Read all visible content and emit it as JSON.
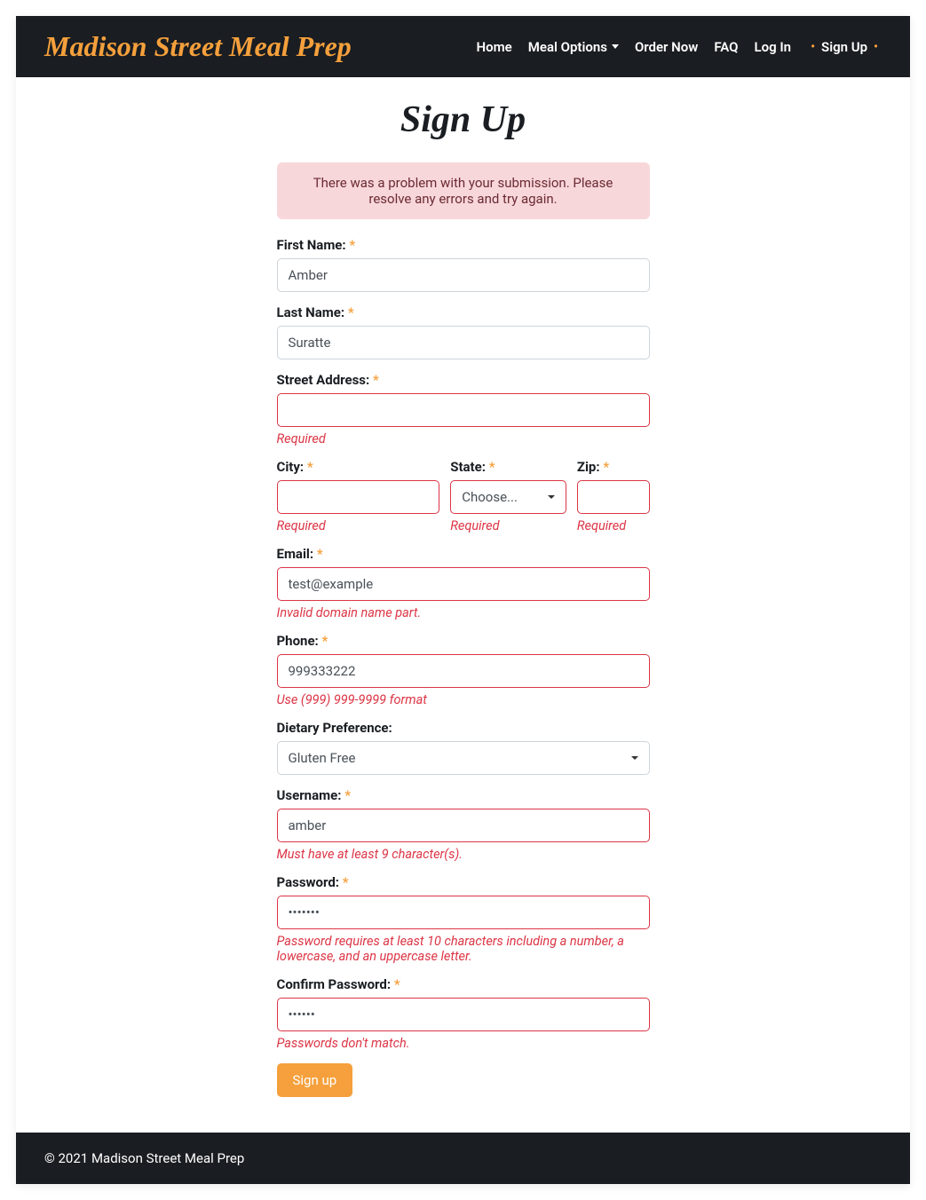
{
  "brand": "Madison Street Meal Prep",
  "nav": {
    "home": "Home",
    "meal_options": "Meal Options",
    "order_now": "Order Now",
    "faq": "FAQ",
    "log_in": "Log In",
    "sign_up": "Sign Up"
  },
  "page_title": "Sign Up",
  "alert": "There was a problem with your submission. Please resolve any errors and try again.",
  "form": {
    "first_name": {
      "label": "First Name:",
      "value": "Amber"
    },
    "last_name": {
      "label": "Last Name:",
      "value": "Suratte"
    },
    "street_address": {
      "label": "Street Address:",
      "value": "",
      "error": "Required"
    },
    "city": {
      "label": "City:",
      "value": "",
      "error": "Required"
    },
    "state": {
      "label": "State:",
      "selected": "Choose...",
      "error": "Required"
    },
    "zip": {
      "label": "Zip:",
      "value": "",
      "error": "Required"
    },
    "email": {
      "label": "Email:",
      "value": "test@example",
      "error": "Invalid domain name part."
    },
    "phone": {
      "label": "Phone:",
      "value": "999333222",
      "error": "Use (999) 999-9999 format"
    },
    "dietary": {
      "label": "Dietary Preference:",
      "selected": "Gluten Free"
    },
    "username": {
      "label": "Username:",
      "value": "amber",
      "error": "Must have at least 9 character(s)."
    },
    "password": {
      "label": "Password:",
      "value": "•••••••",
      "error": "Password requires at least 10 characters including a number, a lowercase, and an uppercase letter."
    },
    "confirm_password": {
      "label": "Confirm Password:",
      "value": "••••••",
      "error": "Passwords don't match."
    },
    "submit": "Sign up"
  },
  "required_star": "*",
  "footer": "© 2021 Madison Street Meal Prep"
}
